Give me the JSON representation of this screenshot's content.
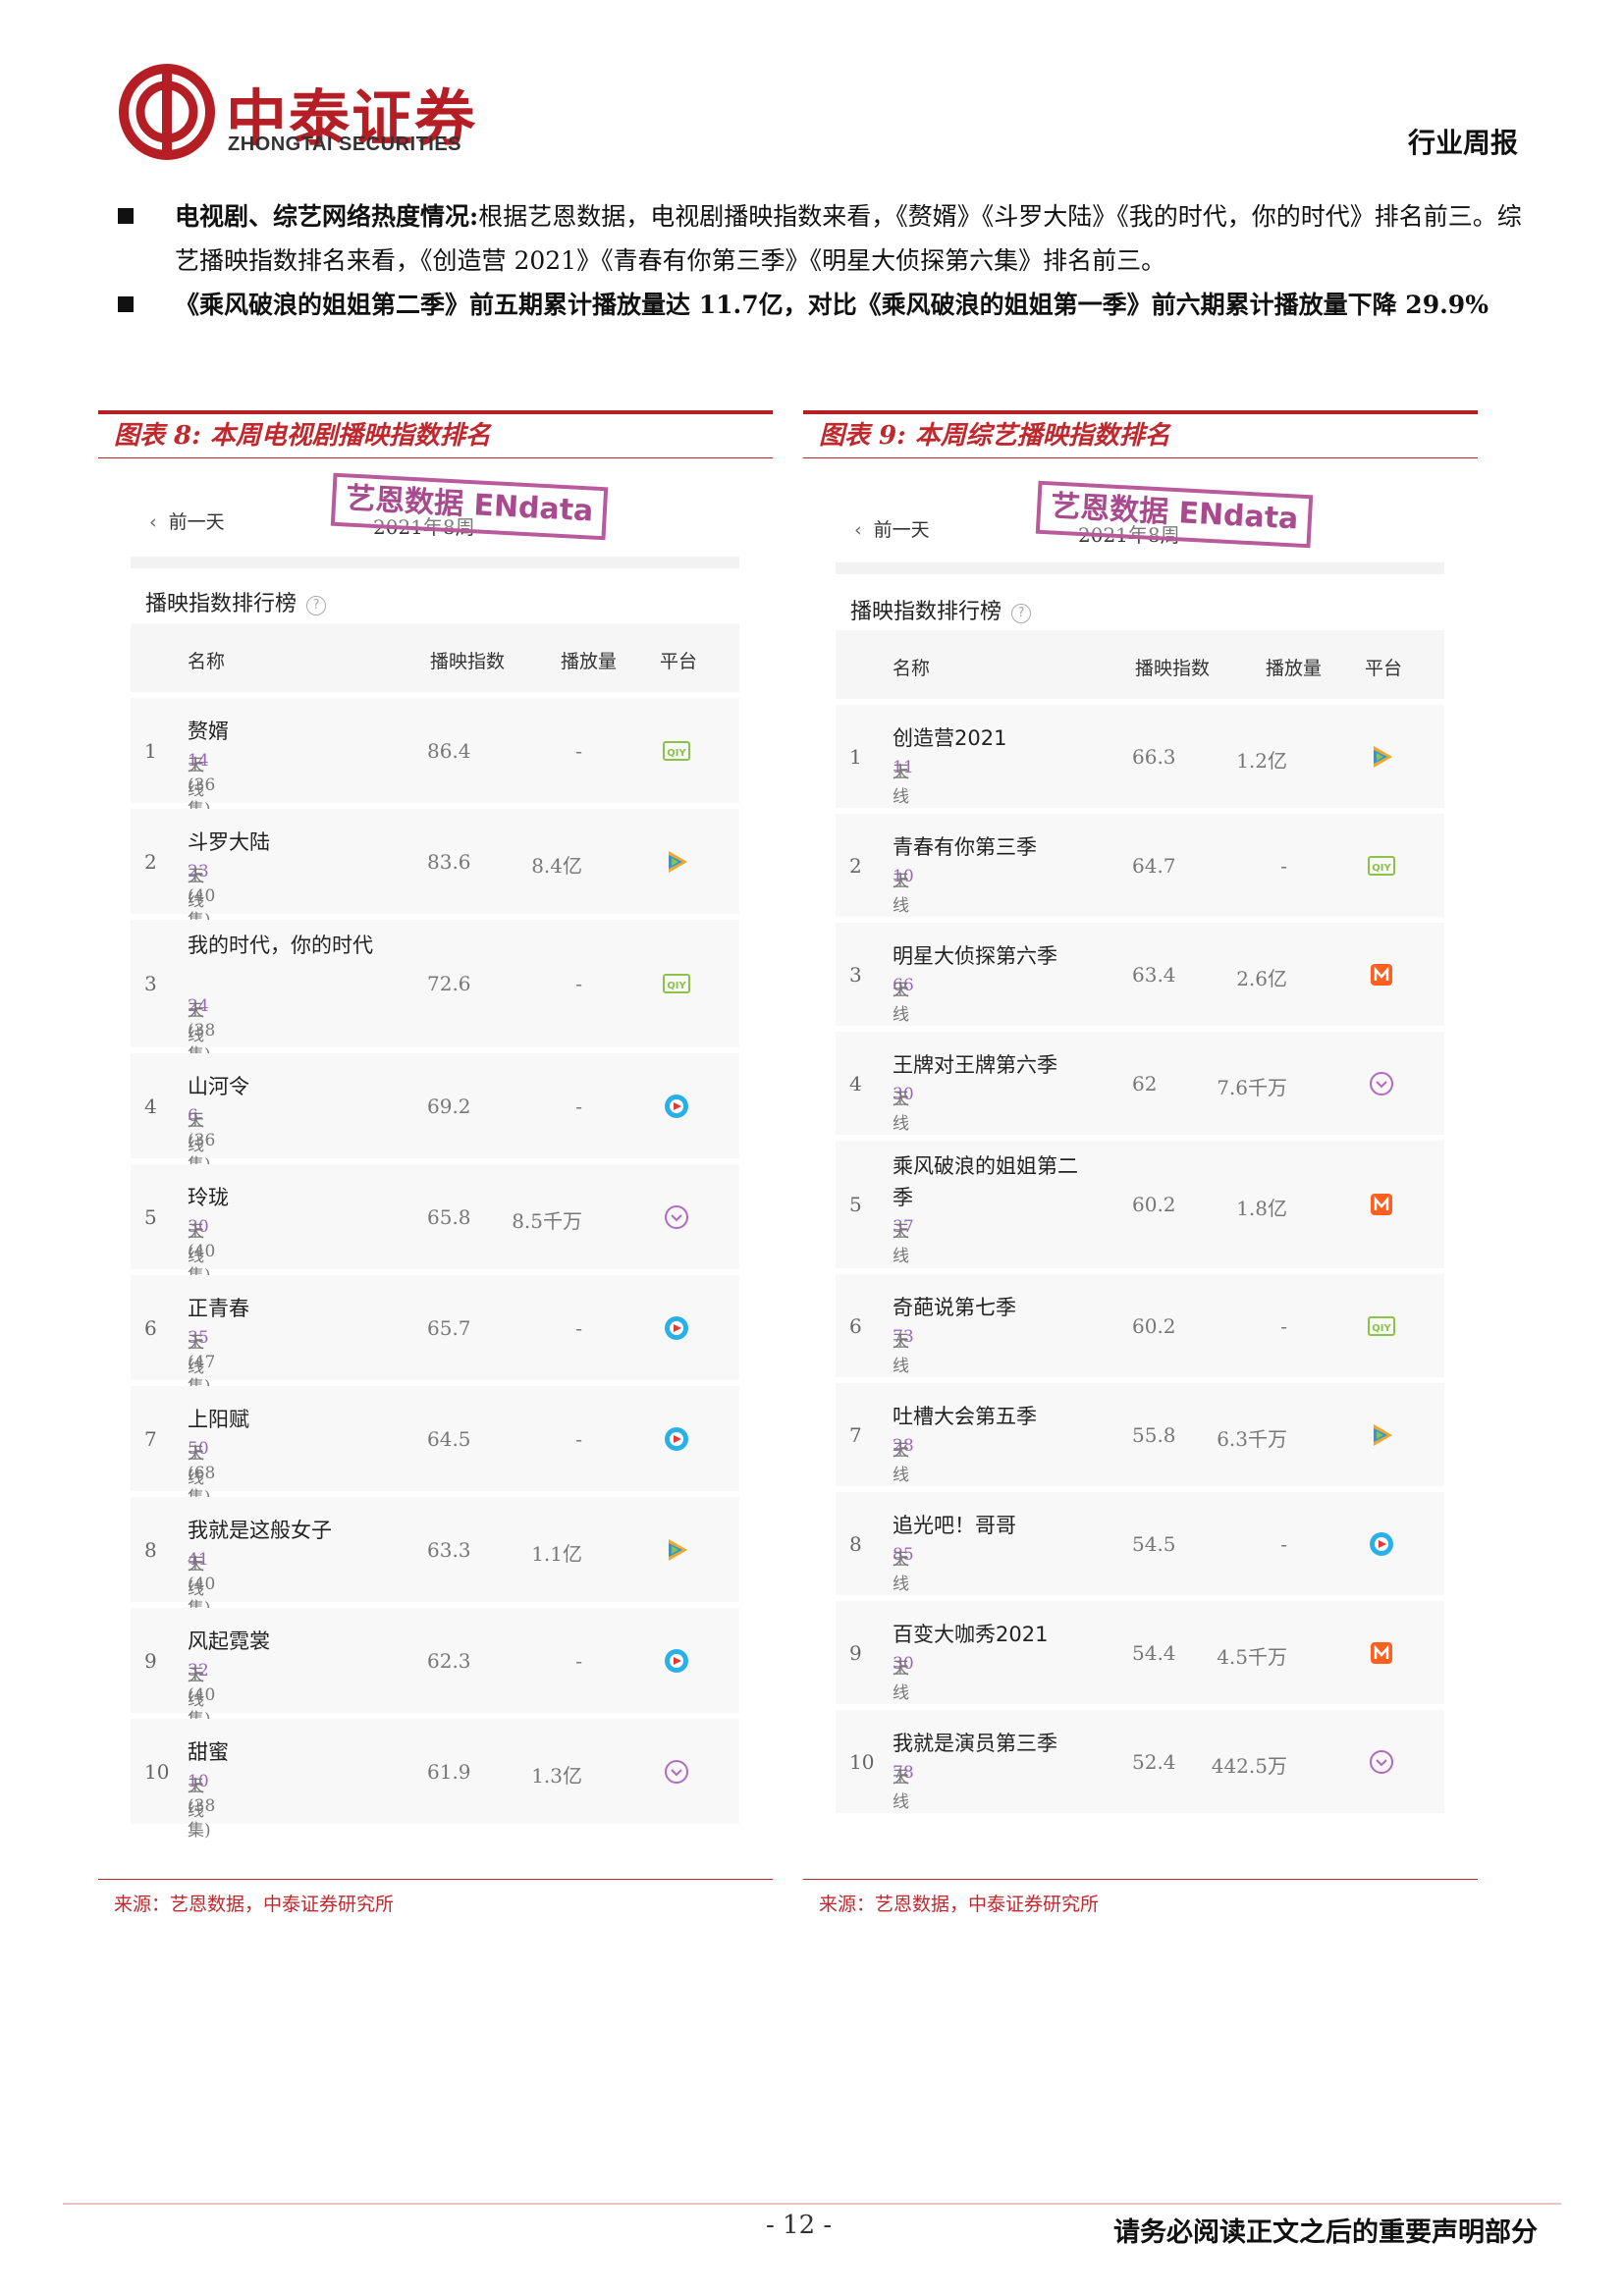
{
  "header": {
    "company_cn": "中泰证券",
    "company_en": "ZHONGTAI SECURITIES",
    "report_type": "行业周报",
    "logo_color": "#b41e24"
  },
  "bullets": [
    {
      "bold": "电视剧、综艺网络热度情况:",
      "text": "根据艺恩数据，电视剧播映指数来看，《赘婿》《斗罗大陆》《我的时代，你的时代》排名前三。综艺播映指数排名来看，《创造营 2021》《青春有你第三季》《明星大侦探第六集》排名前三。"
    },
    {
      "bold": "《乘风破浪的姐姐第二季》前五期累计播放量达 11.7亿，对比《乘风破浪的姐姐第一季》前六期累计播放量下降 29.9%",
      "text": ""
    }
  ],
  "figures": [
    {
      "title": "图表 8:  本周电视剧播映指数排名",
      "prev_day": "前一天",
      "week": "2021年8周",
      "stamp": "艺恩数据 ENdata",
      "rank_title": "播映指数排行榜",
      "columns": [
        "名称",
        "播映指数",
        "播放量",
        "平台"
      ],
      "rows": [
        {
          "rank": "1",
          "name": "赘婿",
          "online": "上线",
          "days": "14",
          "unit": "天 (36集)",
          "index": "86.4",
          "views": "-",
          "platform": "iqiyi-icon"
        },
        {
          "rank": "2",
          "name": "斗罗大陆",
          "online": "上线",
          "days": "23",
          "unit": "天 (40集)",
          "index": "83.6",
          "views": "8.4亿",
          "platform": "tencent-video-icon"
        },
        {
          "rank": "3",
          "name": "我的时代，你的时代",
          "online": "上线",
          "days": "24",
          "unit": "天 (38集)",
          "index": "72.6",
          "views": "-",
          "platform": "iqiyi-icon"
        },
        {
          "rank": "4",
          "name": "山河令",
          "online": "上线",
          "days": "6",
          "unit": "天 (36集)",
          "index": "69.2",
          "views": "-",
          "platform": "youku-icon"
        },
        {
          "rank": "5",
          "name": "玲珑",
          "online": "上线",
          "days": "30",
          "unit": "天 (40集)",
          "index": "65.8",
          "views": "8.5千万",
          "platform": "bilibili-icon"
        },
        {
          "rank": "6",
          "name": "正青春",
          "online": "上线",
          "days": "35",
          "unit": "天 (47集)",
          "index": "65.7",
          "views": "-",
          "platform": "youku-icon"
        },
        {
          "rank": "7",
          "name": "上阳赋",
          "online": "上线",
          "days": "50",
          "unit": "天 (68集)",
          "index": "64.5",
          "views": "-",
          "platform": "youku-icon"
        },
        {
          "rank": "8",
          "name": "我就是这般女子",
          "online": "上线",
          "days": "41",
          "unit": "天 (40集)",
          "index": "63.3",
          "views": "1.1亿",
          "platform": "tencent-video-icon"
        },
        {
          "rank": "9",
          "name": "风起霓裳",
          "online": "上线",
          "days": "32",
          "unit": "天 (40集)",
          "index": "62.3",
          "views": "-",
          "platform": "youku-icon"
        },
        {
          "rank": "10",
          "name": "甜蜜",
          "online": "上线",
          "days": "10",
          "unit": "天 (38集)",
          "index": "61.9",
          "views": "1.3亿",
          "platform": "bilibili-icon"
        }
      ],
      "source": "来源：艺恩数据，中泰证券研究所"
    },
    {
      "title": "图表 9:  本周综艺播映指数排名",
      "prev_day": "前一天",
      "week": "2021年8周",
      "stamp": "艺恩数据 ENdata",
      "rank_title": "播映指数排行榜",
      "columns": [
        "名称",
        "播映指数",
        "播放量",
        "平台"
      ],
      "rows": [
        {
          "rank": "1",
          "name": "创造营2021",
          "online": "上线",
          "days": "11",
          "unit": "天",
          "index": "66.3",
          "views": "1.2亿",
          "platform": "tencent-video-icon"
        },
        {
          "rank": "2",
          "name": "青春有你第三季",
          "online": "上线",
          "days": "10",
          "unit": "天",
          "index": "64.7",
          "views": "-",
          "platform": "iqiyi-icon"
        },
        {
          "rank": "3",
          "name": "明星大侦探第六季",
          "online": "上线",
          "days": "66",
          "unit": "天",
          "index": "63.4",
          "views": "2.6亿",
          "platform": "mgtv-icon"
        },
        {
          "rank": "4",
          "name": "王牌对王牌第六季",
          "online": "上线",
          "days": "30",
          "unit": "天",
          "index": "62",
          "views": "7.6千万",
          "platform": "bilibili-icon"
        },
        {
          "rank": "5",
          "name": "乘风破浪的姐姐第二季",
          "online": "上线",
          "days": "37",
          "unit": "天",
          "index": "60.2",
          "views": "1.8亿",
          "platform": "mgtv-icon"
        },
        {
          "rank": "6",
          "name": "奇葩说第七季",
          "online": "上线",
          "days": "73",
          "unit": "天",
          "index": "60.2",
          "views": "-",
          "platform": "iqiyi-icon"
        },
        {
          "rank": "7",
          "name": "吐槽大会第五季",
          "online": "上线",
          "days": "28",
          "unit": "天",
          "index": "55.8",
          "views": "6.3千万",
          "platform": "tencent-video-icon"
        },
        {
          "rank": "8",
          "name": "追光吧！哥哥",
          "online": "上线",
          "days": "85",
          "unit": "天",
          "index": "54.5",
          "views": "-",
          "platform": "youku-icon"
        },
        {
          "rank": "9",
          "name": "百变大咖秀2021",
          "online": "上线",
          "days": "30",
          "unit": "天",
          "index": "54.4",
          "views": "4.5千万",
          "platform": "mgtv-icon"
        },
        {
          "rank": "10",
          "name": "我就是演员第三季",
          "online": "上线",
          "days": "78",
          "unit": "天",
          "index": "52.4",
          "views": "442.5万",
          "platform": "bilibili-icon"
        }
      ],
      "source": "来源：艺恩数据，中泰证券研究所"
    }
  ],
  "footer": {
    "page_number": "- 12 -",
    "disclaimer": "请务必阅读正文之后的重要声明部分"
  }
}
